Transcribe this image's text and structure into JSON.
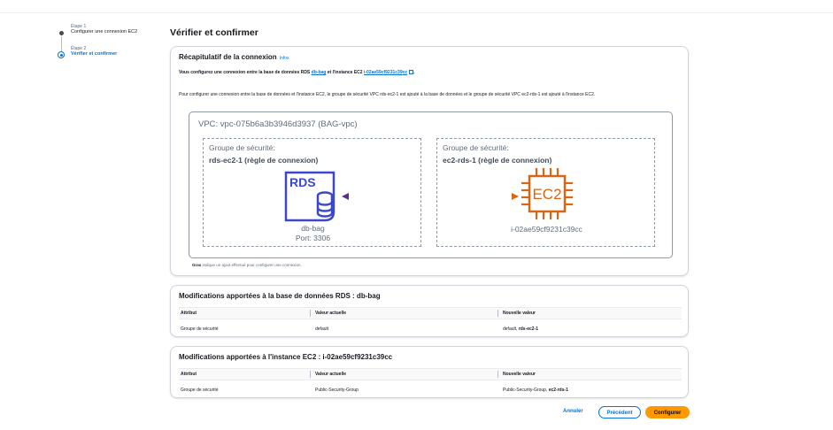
{
  "steps": [
    {
      "number": "Étape 1",
      "label": "Configurer une connexion EC2"
    },
    {
      "number": "Étape 2",
      "label": "Vérifier et confirmer"
    }
  ],
  "page_title": "Vérifier et confirmer",
  "summary_card": {
    "title": "Récapitulatif de la connexion",
    "info_link": "Infos",
    "summary_prefix": "Vous configurez une connexion entre la base de données RDS",
    "db_link": "db-bag",
    "summary_middle": "et l'instance EC2",
    "instance_link": "i-02ae59cf9231c39cc",
    "description": "Pour configurer une connexion entre la base de données et l'instance EC2, le groupe de sécurité VPC rds-ec2-1 est ajouté à la base de données et le groupe de sécurité VPC ec2-rds-1 est ajouté à l'instance EC2.",
    "diagram": {
      "vpc_label": "VPC: vpc-075b6a3b3946d3937 (BAG-vpc)",
      "left_group": {
        "title": "Groupe de sécurité:",
        "name": "rds-ec2-1 (règle de connexion)",
        "icon_text": "RDS",
        "resource": "db-bag",
        "port": "Port: 3306"
      },
      "right_group": {
        "title": "Groupe de sécurité:",
        "name": "ec2-rds-1 (règle de connexion)",
        "icon_text": "EC2",
        "resource": "i-02ae59cf9231c39cc"
      }
    },
    "footnote_bold": "Gras",
    "footnote_rest": "indique un ajout effectué pour configurer une connexion."
  },
  "rds_mods": {
    "title": "Modifications apportées à la base de données RDS : db-bag",
    "columns": [
      "Attribut",
      "Valeur actuelle",
      "Nouvelle valeur"
    ],
    "rows": [
      {
        "attribute": "Groupe de sécurité",
        "current": "default",
        "new_plain": "default,",
        "new_bold": "rds-ec2-1"
      }
    ]
  },
  "ec2_mods": {
    "title": "Modifications apportées à l'instance EC2 : i-02ae59cf9231c39cc",
    "columns": [
      "Attribut",
      "Valeur actuelle",
      "Nouvelle valeur"
    ],
    "rows": [
      {
        "attribute": "Groupe de sécurité",
        "current": "Public-Security-Group",
        "new_plain": "Public-Security-Group,",
        "new_bold": "ec2-rds-1"
      }
    ]
  },
  "actions": {
    "cancel": "Annuler",
    "previous": "Précédent",
    "configure": "Configurer"
  },
  "colors": {
    "rds_icon": "#3b48cc",
    "ec2_icon": "#d86613",
    "link": "#0972d3",
    "primary_button": "#ff9900",
    "connector": "#5c2d91"
  }
}
